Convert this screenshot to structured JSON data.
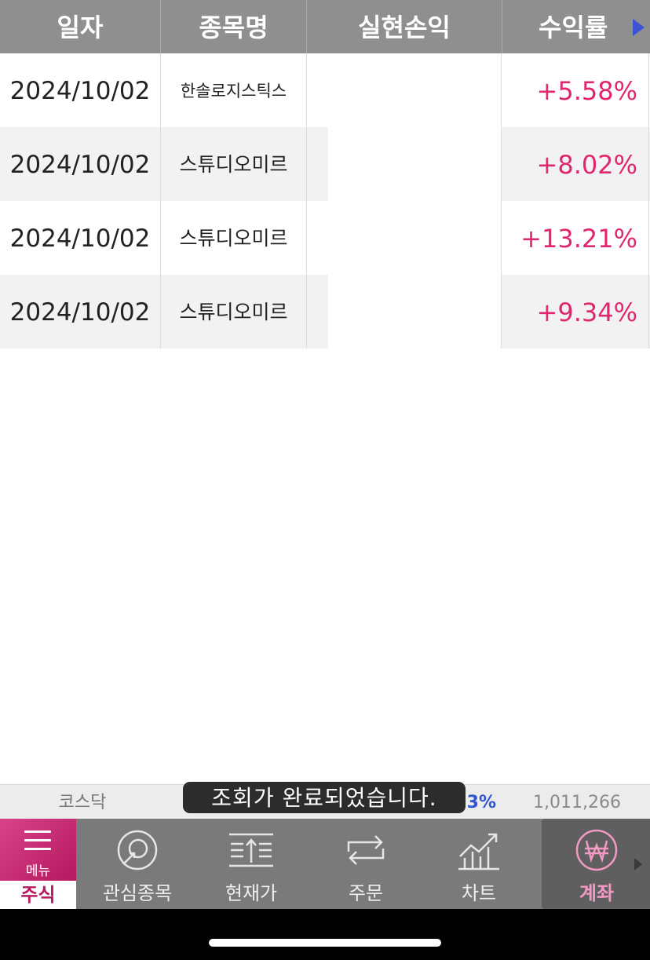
{
  "table": {
    "headers": [
      "일자",
      "종목명",
      "실현손익",
      "수익률"
    ],
    "rows": [
      {
        "date": "2024/10/02",
        "name": "한솔로지스틱스",
        "pnl": "",
        "rate": "+5.58%"
      },
      {
        "date": "2024/10/02",
        "name": "스튜디오미르",
        "pnl": "",
        "rate": "+8.02%"
      },
      {
        "date": "2024/10/02",
        "name": "스튜디오미르",
        "pnl": "",
        "rate": "+13.21%"
      },
      {
        "date": "2024/10/02",
        "name": "스튜디오미르",
        "pnl": "",
        "rate": "+9.34%"
      }
    ]
  },
  "ticker": {
    "market": "코스닥",
    "change": "0.23%",
    "value": "1,011,266"
  },
  "toast": "조회가 완료되었습니다.",
  "nav": {
    "menu_label": "메뉴",
    "stock_label": "주식",
    "items": [
      {
        "label": "관심종목",
        "icon": "watchlist-icon"
      },
      {
        "label": "현재가",
        "icon": "current-price-icon"
      },
      {
        "label": "주문",
        "icon": "order-icon"
      },
      {
        "label": "차트",
        "icon": "chart-icon"
      },
      {
        "label": "계좌",
        "icon": "won-icon"
      }
    ]
  },
  "colors": {
    "header_bg": "#8f8f8f",
    "positive": "#e0266f",
    "accent": "#b5195f",
    "ticker_change": "#2f55d4"
  }
}
